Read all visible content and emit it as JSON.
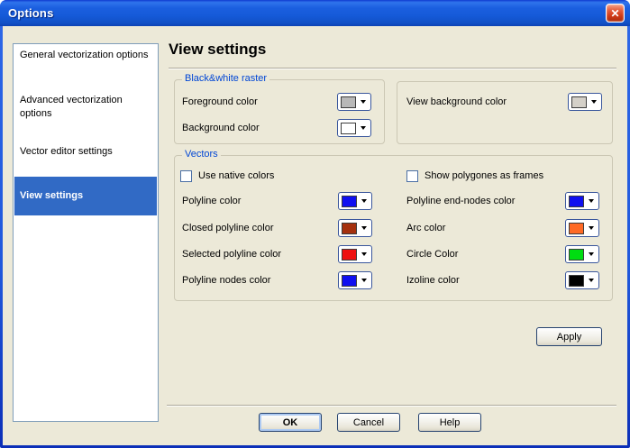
{
  "window": {
    "title": "Options"
  },
  "icons": {
    "close": "✕",
    "dropdown_arrow": "▼"
  },
  "theme": {
    "dialog_bg": "#ece9d8",
    "titlebar_blue": "#155ad8",
    "selection_bg": "#316ac5",
    "group_caption_blue": "#0046d5",
    "sidebar_border": "#7f9db9"
  },
  "sidebar": {
    "items": [
      {
        "label": "General vectorization options",
        "selected": false
      },
      {
        "label": "Advanced vectorization options",
        "selected": false
      },
      {
        "label": "Vector editor settings",
        "selected": false
      },
      {
        "label": "View settings",
        "selected": true
      }
    ]
  },
  "main": {
    "heading": "View settings",
    "bw_raster": {
      "caption": "Black&white raster",
      "rows": [
        {
          "label": "Foreground color",
          "color": "#b8b8b8"
        },
        {
          "label": "Background color",
          "color": "#ffffff"
        }
      ]
    },
    "view_bg": {
      "rows": [
        {
          "label": "View background color",
          "color": "#d4d0c8"
        }
      ]
    },
    "vectors": {
      "caption": "Vectors",
      "checkboxes": [
        {
          "label": "Use native colors",
          "checked": false
        },
        {
          "label": "Show polygones as frames",
          "checked": false
        }
      ],
      "left_rows": [
        {
          "label": "Polyline color",
          "color": "#0f0ff0"
        },
        {
          "label": "Closed polyline color",
          "color": "#a5300e"
        },
        {
          "label": "Selected polyline color",
          "color": "#ee1010"
        },
        {
          "label": "Polyline nodes color",
          "color": "#0f0ff0"
        }
      ],
      "right_rows": [
        {
          "label": "Polyline end-nodes color",
          "color": "#0f0ff0"
        },
        {
          "label": "Arc color",
          "color": "#ff6a25"
        },
        {
          "label": "Circle Color",
          "color": "#00dd11"
        },
        {
          "label": "Izoline color",
          "color": "#000000"
        }
      ]
    },
    "apply_label": "Apply"
  },
  "footer": {
    "ok_label": "OK",
    "cancel_label": "Cancel",
    "help_label": "Help"
  }
}
